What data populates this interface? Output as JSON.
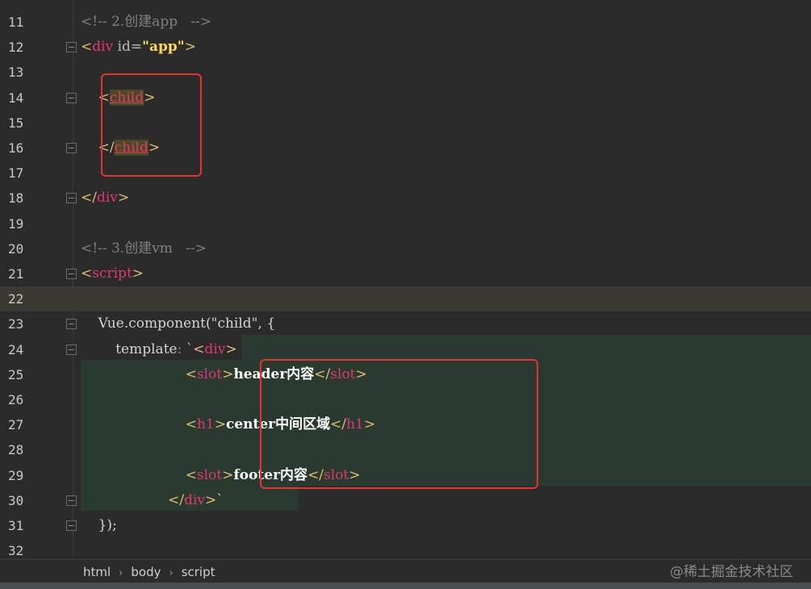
{
  "lines": [
    {
      "n": "11",
      "html": [
        [
          "comment",
          "<!-- 2.创建app   -->"
        ]
      ]
    },
    {
      "n": "12",
      "html": [
        [
          "tag-br",
          "<"
        ],
        [
          "tag",
          "div"
        ],
        [
          "attr",
          " id="
        ],
        [
          "val",
          "\"app\""
        ],
        [
          "tag-br",
          ">"
        ]
      ]
    },
    {
      "n": "13",
      "html": []
    },
    {
      "n": "14",
      "html": [
        [
          "plain",
          "    "
        ],
        [
          "tag-br",
          "<"
        ],
        [
          "child",
          "child"
        ],
        [
          "tag-br",
          ">"
        ]
      ]
    },
    {
      "n": "15",
      "html": []
    },
    {
      "n": "16",
      "html": [
        [
          "plain",
          "    "
        ],
        [
          "tag-br",
          "</"
        ],
        [
          "child",
          "child"
        ],
        [
          "tag-br",
          ">"
        ]
      ]
    },
    {
      "n": "17",
      "html": []
    },
    {
      "n": "18",
      "html": [
        [
          "tag-br",
          "</"
        ],
        [
          "tag",
          "div"
        ],
        [
          "tag-br",
          ">"
        ]
      ]
    },
    {
      "n": "19",
      "html": []
    },
    {
      "n": "20",
      "html": [
        [
          "comment",
          "<!-- 3.创建vm   -->"
        ]
      ]
    },
    {
      "n": "21",
      "html": [
        [
          "tag-br",
          "<"
        ],
        [
          "tag",
          "script"
        ],
        [
          "tag-br",
          ">"
        ]
      ]
    },
    {
      "n": "22",
      "html": []
    },
    {
      "n": "23",
      "html": [
        [
          "plain",
          "    Vue.component("
        ],
        [
          "str",
          "\"child\""
        ],
        [
          "plain",
          ", {"
        ]
      ]
    },
    {
      "n": "24",
      "html": [
        [
          "plain",
          "        template"
        ],
        [
          "punct",
          ":"
        ],
        [
          "plain",
          " `"
        ],
        [
          "tag-br",
          "<"
        ],
        [
          "tag",
          "div"
        ],
        [
          "tag-br",
          ">"
        ]
      ]
    },
    {
      "n": "25",
      "html": [
        [
          "plain",
          "                        "
        ],
        [
          "tag-br",
          "<"
        ],
        [
          "tag",
          "slot"
        ],
        [
          "tag-br",
          ">"
        ],
        [
          "bold",
          "header内容"
        ],
        [
          "tag-br",
          "</"
        ],
        [
          "tag",
          "slot"
        ],
        [
          "tag-br",
          ">"
        ]
      ]
    },
    {
      "n": "26",
      "html": []
    },
    {
      "n": "27",
      "html": [
        [
          "plain",
          "                        "
        ],
        [
          "tag-br",
          "<"
        ],
        [
          "tag",
          "h1"
        ],
        [
          "tag-br",
          ">"
        ],
        [
          "bold",
          "center中间区域"
        ],
        [
          "tag-br",
          "</"
        ],
        [
          "tag",
          "h1"
        ],
        [
          "tag-br",
          ">"
        ]
      ]
    },
    {
      "n": "28",
      "html": []
    },
    {
      "n": "29",
      "html": [
        [
          "plain",
          "                        "
        ],
        [
          "tag-br",
          "<"
        ],
        [
          "tag",
          "slot"
        ],
        [
          "tag-br",
          ">"
        ],
        [
          "bold",
          "footer内容"
        ],
        [
          "tag-br",
          "</"
        ],
        [
          "tag",
          "slot"
        ],
        [
          "tag-br",
          ">"
        ]
      ]
    },
    {
      "n": "30",
      "html": [
        [
          "plain",
          "                    "
        ],
        [
          "tag-br",
          "</"
        ],
        [
          "tag",
          "div"
        ],
        [
          "tag-br",
          ">"
        ],
        [
          "plain",
          "`"
        ]
      ]
    },
    {
      "n": "31",
      "html": [
        [
          "plain",
          "    });"
        ]
      ]
    },
    {
      "n": "32",
      "html": []
    }
  ],
  "fold_lines": [
    "12",
    "14",
    "16",
    "18",
    "21",
    "23",
    "24",
    "30",
    "31"
  ],
  "current_line": "22",
  "breadcrumb": [
    "html",
    "body",
    "script"
  ],
  "watermark": "@稀土掘金技术社区",
  "colors": {
    "background": "#2b2b2b",
    "tag": "#e0386f",
    "highlight_box": "#e8322d"
  }
}
